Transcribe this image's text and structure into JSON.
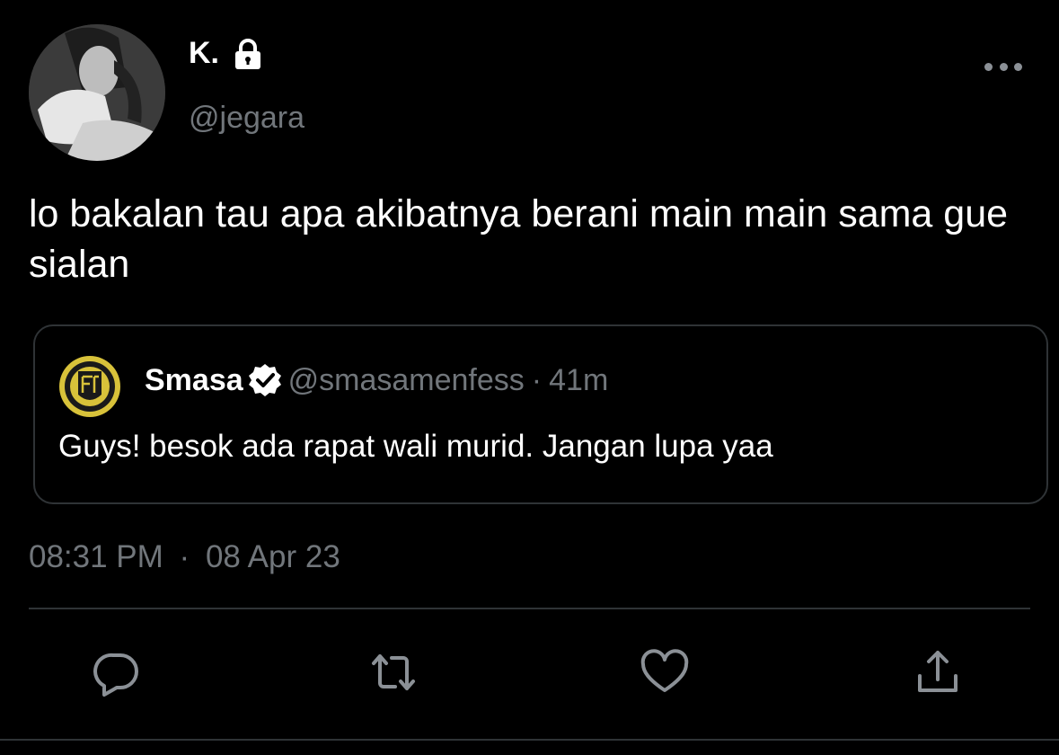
{
  "tweet": {
    "author_name": "K.",
    "author_handle": "@jegara",
    "text": "lo bakalan tau apa akibatnya berani main main sama gue sialan",
    "time": "08:31 PM",
    "separator": "·",
    "date": "08 Apr 23"
  },
  "quote": {
    "author_name": "Smasa",
    "author_handle": "@smasamenfess",
    "separator": "·",
    "age": "41m",
    "text": "Guys! besok ada rapat wali murid. Jangan lupa yaa"
  },
  "icons": {
    "lock": "lock-icon",
    "more": "more-icon",
    "verified": "verified-badge-icon",
    "reply": "reply-icon",
    "retweet": "retweet-icon",
    "like": "like-icon",
    "share": "share-icon"
  },
  "colors": {
    "background": "#000000",
    "primary_text": "#ffffff",
    "secondary_text": "#71767b",
    "border": "#2f3336",
    "icon": "#8b9096",
    "logo_gold": "#d8c23a"
  }
}
